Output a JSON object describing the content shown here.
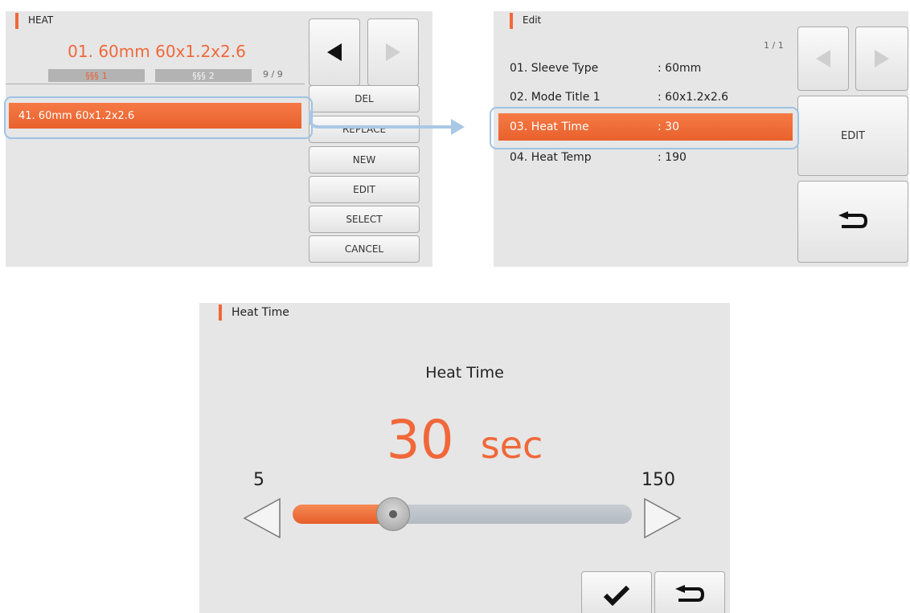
{
  "panel1": {
    "header": "HEAT",
    "title": "01. 60mm 60x1.2x2.6",
    "heater1_label": "1",
    "heater2_label": "2",
    "page_count": "9 / 9",
    "selected_item": "41. 60mm 60x1.2x2.6",
    "buttons": [
      "DEL",
      "REPLACE",
      "NEW",
      "EDIT",
      "SELECT",
      "CANCEL"
    ],
    "icons": [
      "prev-arrow-icon",
      "next-arrow-icon",
      "heater-icon"
    ]
  },
  "panel2": {
    "header": "Edit",
    "page_count": "1 / 1",
    "rows": [
      {
        "label": "01.  Sleeve Type",
        "value": ": 60mm"
      },
      {
        "label": "02.  Mode Title 1",
        "value": ": 60x1.2x2.6"
      },
      {
        "label": "03.  Heat Time",
        "value": ": 30"
      },
      {
        "label": "04.  Heat Temp",
        "value": ": 190"
      }
    ],
    "edit_button": "EDIT",
    "icons": [
      "prev-arrow-icon",
      "next-arrow-icon",
      "return-icon"
    ]
  },
  "panel3": {
    "header": "Heat Time",
    "caption": "Heat Time",
    "value": "30",
    "unit": "sec",
    "min_label": "5",
    "max_label": "150",
    "slider_value": 30,
    "slider_min": 5,
    "slider_max": 150,
    "icons": [
      "decrease-arrow-icon",
      "increase-arrow-icon",
      "check-icon",
      "return-icon"
    ]
  },
  "colors": {
    "accent": "#f0683a",
    "highlight_outline": "#9ec3e4",
    "panel_bg": "#e6e6e6"
  }
}
